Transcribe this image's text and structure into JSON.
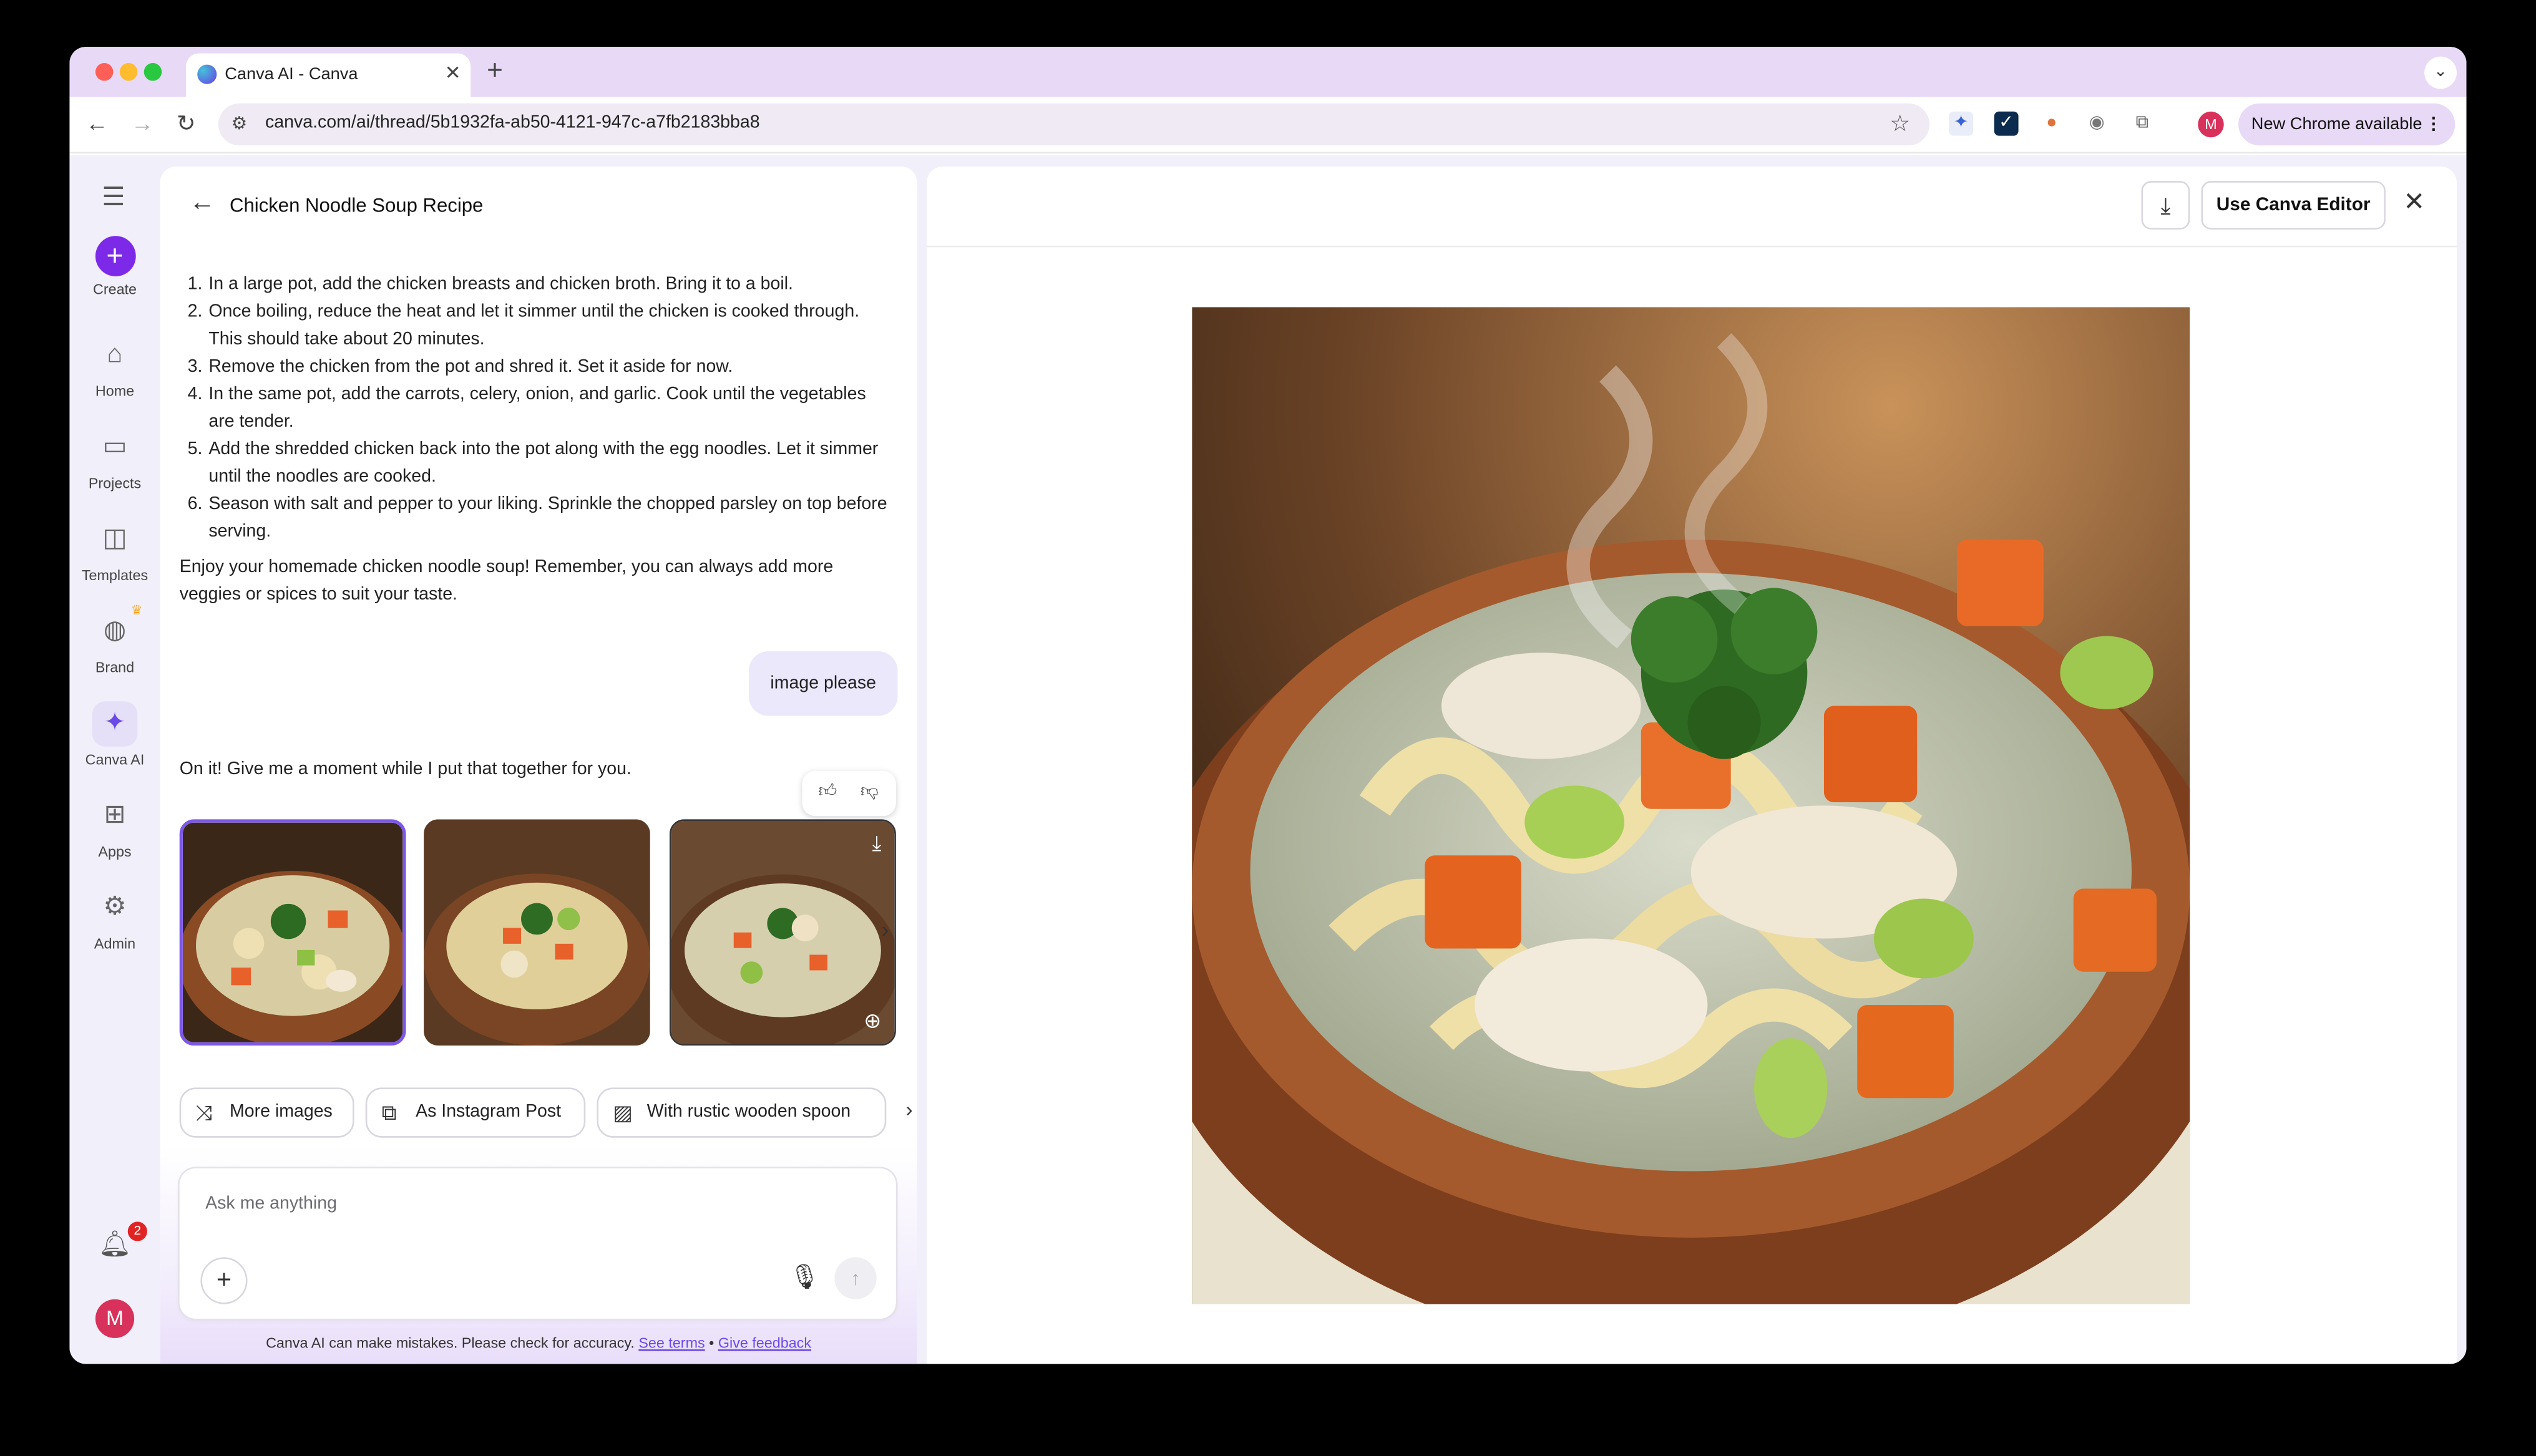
{
  "browser": {
    "tab_title": "Canva AI - Canva",
    "url": "canva.com/ai/thread/5b1932fa-ab50-4121-947c-a7fb2183bba8",
    "new_chrome_label": "New Chrome available",
    "profile_initial": "M"
  },
  "rail": {
    "items": [
      {
        "label": "Create",
        "icon": "plus-icon"
      },
      {
        "label": "Home",
        "icon": "home-icon"
      },
      {
        "label": "Projects",
        "icon": "folder-icon"
      },
      {
        "label": "Templates",
        "icon": "templates-icon"
      },
      {
        "label": "Brand",
        "icon": "brand-icon"
      },
      {
        "label": "Canva AI",
        "icon": "sparkle-icon"
      },
      {
        "label": "Apps",
        "icon": "apps-icon"
      },
      {
        "label": "Admin",
        "icon": "gear-icon"
      }
    ],
    "notification_count": "2",
    "user_initial": "M"
  },
  "chat": {
    "title": "Chicken Noodle Soup Recipe",
    "steps": [
      {
        "num": "1.",
        "text": "In a large pot, add the chicken breasts and chicken broth. Bring it to a boil."
      },
      {
        "num": "2.",
        "text": "Once boiling, reduce the heat and let it simmer until the chicken is cooked through. This should take about 20 minutes."
      },
      {
        "num": "3.",
        "text": "Remove the chicken from the pot and shred it. Set it aside for now."
      },
      {
        "num": "4.",
        "text": "In the same pot, add the carrots, celery, onion, and garlic. Cook until the vegetables are tender."
      },
      {
        "num": "5.",
        "text": "Add the shredded chicken back into the pot along with the egg noodles. Let it simmer until the noodles are cooked."
      },
      {
        "num": "6.",
        "text": "Season with salt and pepper to your liking. Sprinkle the chopped parsley on top before serving."
      }
    ],
    "closing": "Enjoy your homemade chicken noodle soup! Remember, you can always add more veggies or spices to suit your taste.",
    "user_message": "image please",
    "ai_reply": "On it! Give me a moment while I put that together for you.",
    "suggestions": [
      {
        "label": "More images",
        "icon": "shuffle-icon"
      },
      {
        "label": "As Instagram Post",
        "icon": "resize-icon"
      },
      {
        "label": "With rustic wooden spoon",
        "icon": "image-edit-icon"
      }
    ],
    "composer_placeholder": "Ask me anything",
    "disclaimer": "Canva AI can make mistakes. Please check for accuracy.",
    "see_terms": "See terms",
    "separator": "•",
    "give_feedback": "Give feedback"
  },
  "preview": {
    "editor_button": "Use Canva Editor"
  },
  "colors": {
    "accent": "#7d2ae8",
    "tab_strip": "#e8d9f7"
  }
}
